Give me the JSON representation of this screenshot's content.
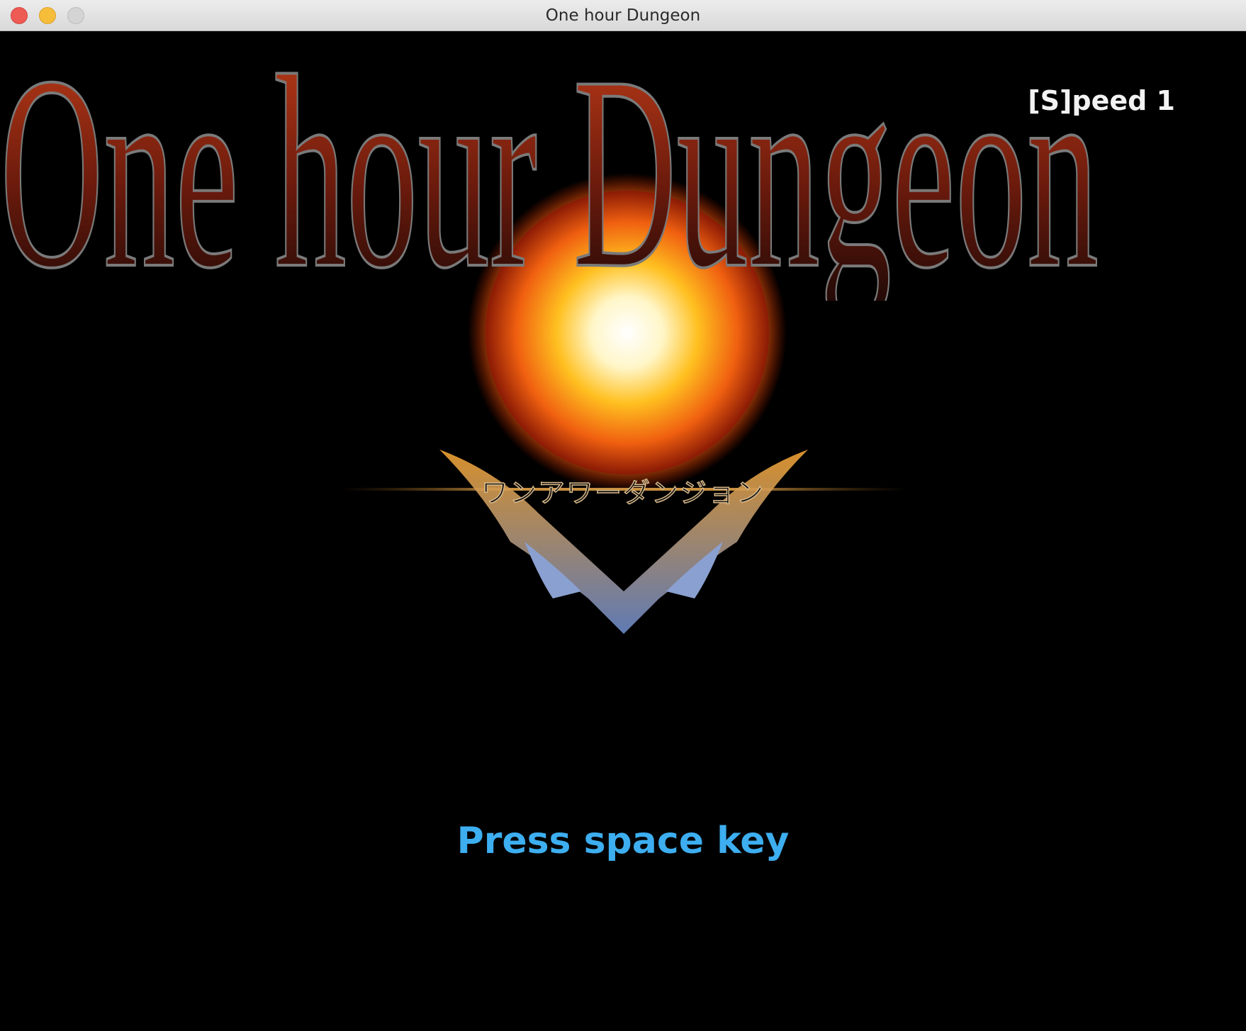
{
  "window": {
    "title": "One hour Dungeon"
  },
  "hud": {
    "speed_label": "[S]peed 1"
  },
  "logo": {
    "title": "One hour Dungeon",
    "subtitle": "ワンアワーダンジョン"
  },
  "prompt": {
    "text": "Press space key",
    "color": "#3daef0"
  },
  "colors": {
    "background": "#000000",
    "title_fill_top": "#c8401a",
    "title_fill_bottom": "#1a0a08",
    "sun_core": "#fffbe0",
    "sun_edge": "#e04010"
  }
}
